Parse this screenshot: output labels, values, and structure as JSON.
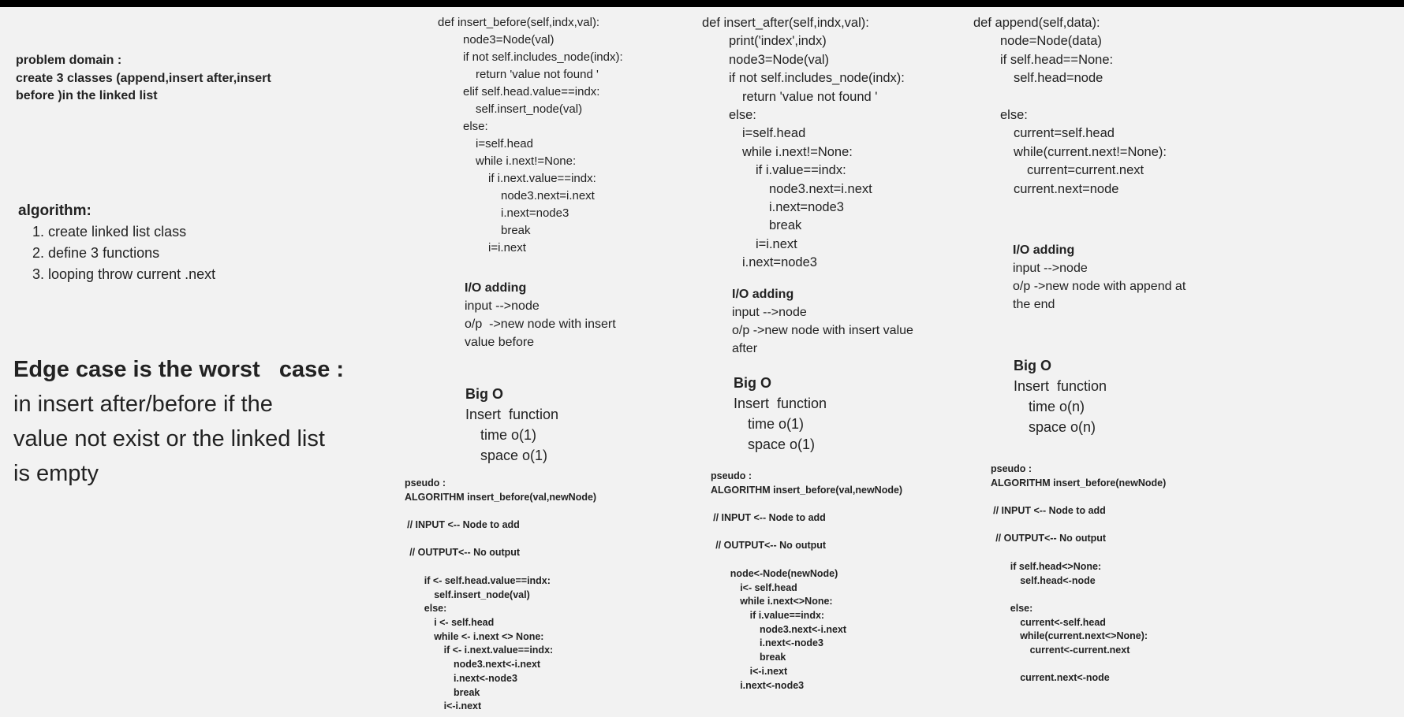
{
  "problem_domain": {
    "heading": "problem domain :",
    "lines": [
      "create 3 classes (append,insert after,insert",
      "before )in the linked list"
    ]
  },
  "algorithm": {
    "heading": "algorithm:",
    "items": [
      "1. create linked list class",
      "2. define 3 functions",
      "3. looping throw current .next"
    ]
  },
  "edge_case": {
    "heading": "Edge case is the worst   case :",
    "lines": [
      "in insert after/before  if the",
      "value not exist or the linked list",
      "is empty"
    ]
  },
  "columns": [
    {
      "code": [
        "def insert_before(self,indx,val):",
        "    node3=Node(val)",
        "    if not self.includes_node(indx):",
        "      return 'value not found '",
        "    elif self.head.value==indx:",
        "      self.insert_node(val)",
        "    else:",
        "      i=self.head",
        "      while i.next!=None:",
        "        if i.next.value==indx:",
        "          node3.next=i.next",
        "          i.next=node3",
        "          break",
        "        i=i.next"
      ],
      "io": {
        "title": "I/O adding",
        "lines": [
          "input -->node",
          "o/p  ->new node with insert",
          "value before"
        ]
      },
      "bigo": {
        "title": "Big O",
        "fn": "Insert  function",
        "time": "time o(1)",
        "space": "space o(1)"
      },
      "pseudo": [
        "pseudo :",
        "ALGORITHM insert_before(val,newNode)",
        "",
        " // INPUT <-- Node to add",
        "",
        "  // OUTPUT<-- No output",
        "",
        "        if <- self.head.value==indx:",
        "            self.insert_node(val)",
        "        else:",
        "            i <- self.head",
        "            while <- i.next <> None:",
        "                if <- i.next.value==indx:",
        "                    node3.next<-i.next",
        "                    i.next<-node3",
        "                    break",
        "                i<-i.next"
      ]
    },
    {
      "code": [
        "def insert_after(self,indx,val):",
        "    print('index',indx)",
        "    node3=Node(val)",
        "    if not self.includes_node(indx):",
        "      return 'value not found '",
        "    else:",
        "      i=self.head",
        "      while i.next!=None:",
        "        if i.value==indx:",
        "          node3.next=i.next",
        "          i.next=node3",
        "          break",
        "        i=i.next",
        "      i.next=node3"
      ],
      "io": {
        "title": "I/O adding",
        "lines": [
          "input -->node",
          "o/p ->new node with insert value",
          "after"
        ]
      },
      "bigo": {
        "title": "Big O",
        "fn": "Insert  function",
        "time": "time o(1)",
        "space": "space o(1)"
      },
      "pseudo": [
        "pseudo :",
        "ALGORITHM insert_before(val,newNode)",
        "",
        " // INPUT <-- Node to add",
        "",
        "  // OUTPUT<-- No output",
        "",
        "        node<-Node(newNode)",
        "            i<- self.head",
        "            while i.next<>None:",
        "                if i.value==indx:",
        "                    node3.next<-i.next",
        "                    i.next<-node3",
        "                    break",
        "                i<-i.next",
        "            i.next<-node3"
      ]
    },
    {
      "code": [
        "def append(self,data):",
        "    node=Node(data)",
        "    if self.head==None:",
        "      self.head=node",
        "",
        "    else:",
        "      current=self.head",
        "      while(current.next!=None):",
        "        current=current.next",
        "      current.next=node"
      ],
      "io": {
        "title": "I/O adding",
        "lines": [
          "input -->node",
          "o/p ->new node with append at",
          "the end"
        ]
      },
      "bigo": {
        "title": "Big O",
        "fn": "Insert  function",
        "time": "time o(n)",
        "space": "space o(n)"
      },
      "pseudo": [
        "pseudo :",
        "ALGORITHM insert_before(newNode)",
        "",
        " // INPUT <-- Node to add",
        "",
        "  // OUTPUT<-- No output",
        "",
        "        if self.head<>None:",
        "            self.head<-node",
        "",
        "        else:",
        "            current<-self.head",
        "            while(current.next<>None):",
        "                current<-current.next",
        "",
        "            current.next<-node"
      ]
    }
  ]
}
